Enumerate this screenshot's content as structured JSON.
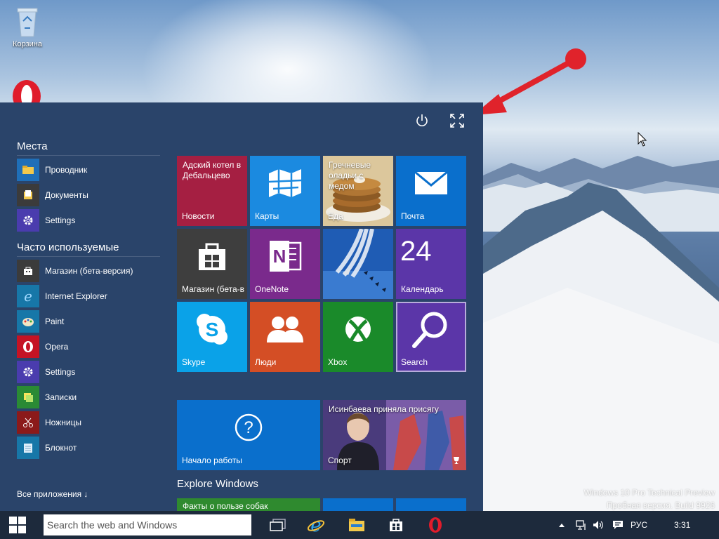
{
  "desktop": {
    "recycle_bin_label": "Корзина",
    "watermark_line1": "Windows 10 Pro Technical Preview",
    "watermark_line2": "Пробная версия. Build 9926"
  },
  "start_menu": {
    "places_title": "Места",
    "places": [
      {
        "label": "Проводник",
        "icon": "folder-icon",
        "color": "#1f6fb8"
      },
      {
        "label": "Документы",
        "icon": "documents-icon",
        "color": "#3b3b3b"
      },
      {
        "label": "Settings",
        "icon": "gear-icon",
        "color": "#4a3cae"
      }
    ],
    "frequent_title": "Часто используемые",
    "frequent": [
      {
        "label": "Магазин (бета-версия)",
        "icon": "store-icon",
        "color": "#3b3b3b"
      },
      {
        "label": "Internet Explorer",
        "icon": "ie-icon",
        "color": "#1777a8"
      },
      {
        "label": "Paint",
        "icon": "paint-icon",
        "color": "#1777a8"
      },
      {
        "label": "Opera",
        "icon": "opera-icon",
        "color": "#c51324"
      },
      {
        "label": "Settings",
        "icon": "gear-icon",
        "color": "#4a3cae"
      },
      {
        "label": "Записки",
        "icon": "notes-icon",
        "color": "#2a8a35"
      },
      {
        "label": "Ножницы",
        "icon": "scissors-icon",
        "color": "#8b1a1a"
      },
      {
        "label": "Блокнот",
        "icon": "notepad-icon",
        "color": "#1777a8"
      }
    ],
    "all_apps_label": "Все приложения ↓",
    "explore_title": "Explore Windows"
  },
  "tiles": {
    "news": {
      "text": "Адский котел в Дебальцево",
      "label": "Новости",
      "color": "#a51f42"
    },
    "maps": {
      "label": "Карты",
      "color": "#1b8ae0"
    },
    "food": {
      "text": "Гречневые оладьи с медом",
      "label": "Еда",
      "color": "#c7a35a"
    },
    "mail": {
      "label": "Почта",
      "color": "#0a6fcc"
    },
    "store": {
      "label": "Магазин (бета-в",
      "color": "#3e3e3e"
    },
    "onenote": {
      "label": "OneNote",
      "color": "#7a2a8c"
    },
    "photo": {
      "color": "#2057a8"
    },
    "calendar": {
      "number": "24",
      "label": "Календарь",
      "color": "#5b36a8"
    },
    "skype": {
      "label": "Skype",
      "color": "#0aa2e8"
    },
    "people": {
      "label": "Люди",
      "color": "#d44e25"
    },
    "xbox": {
      "label": "Xbox",
      "color": "#1a8a2a"
    },
    "search": {
      "label": "Search",
      "color": "#5b36a8"
    },
    "getstarted": {
      "label": "Начало работы",
      "color": "#0a6fcc"
    },
    "sport": {
      "text": "Исинбаева приняла присягу",
      "label": "Спорт",
      "color": "#5b3d8a"
    },
    "facts": {
      "text": "Факты о пользе собак",
      "color": "#2f8a2f"
    }
  },
  "taskbar": {
    "search_placeholder": "Search the web and Windows",
    "lang": "РУС",
    "time": "3:31"
  }
}
